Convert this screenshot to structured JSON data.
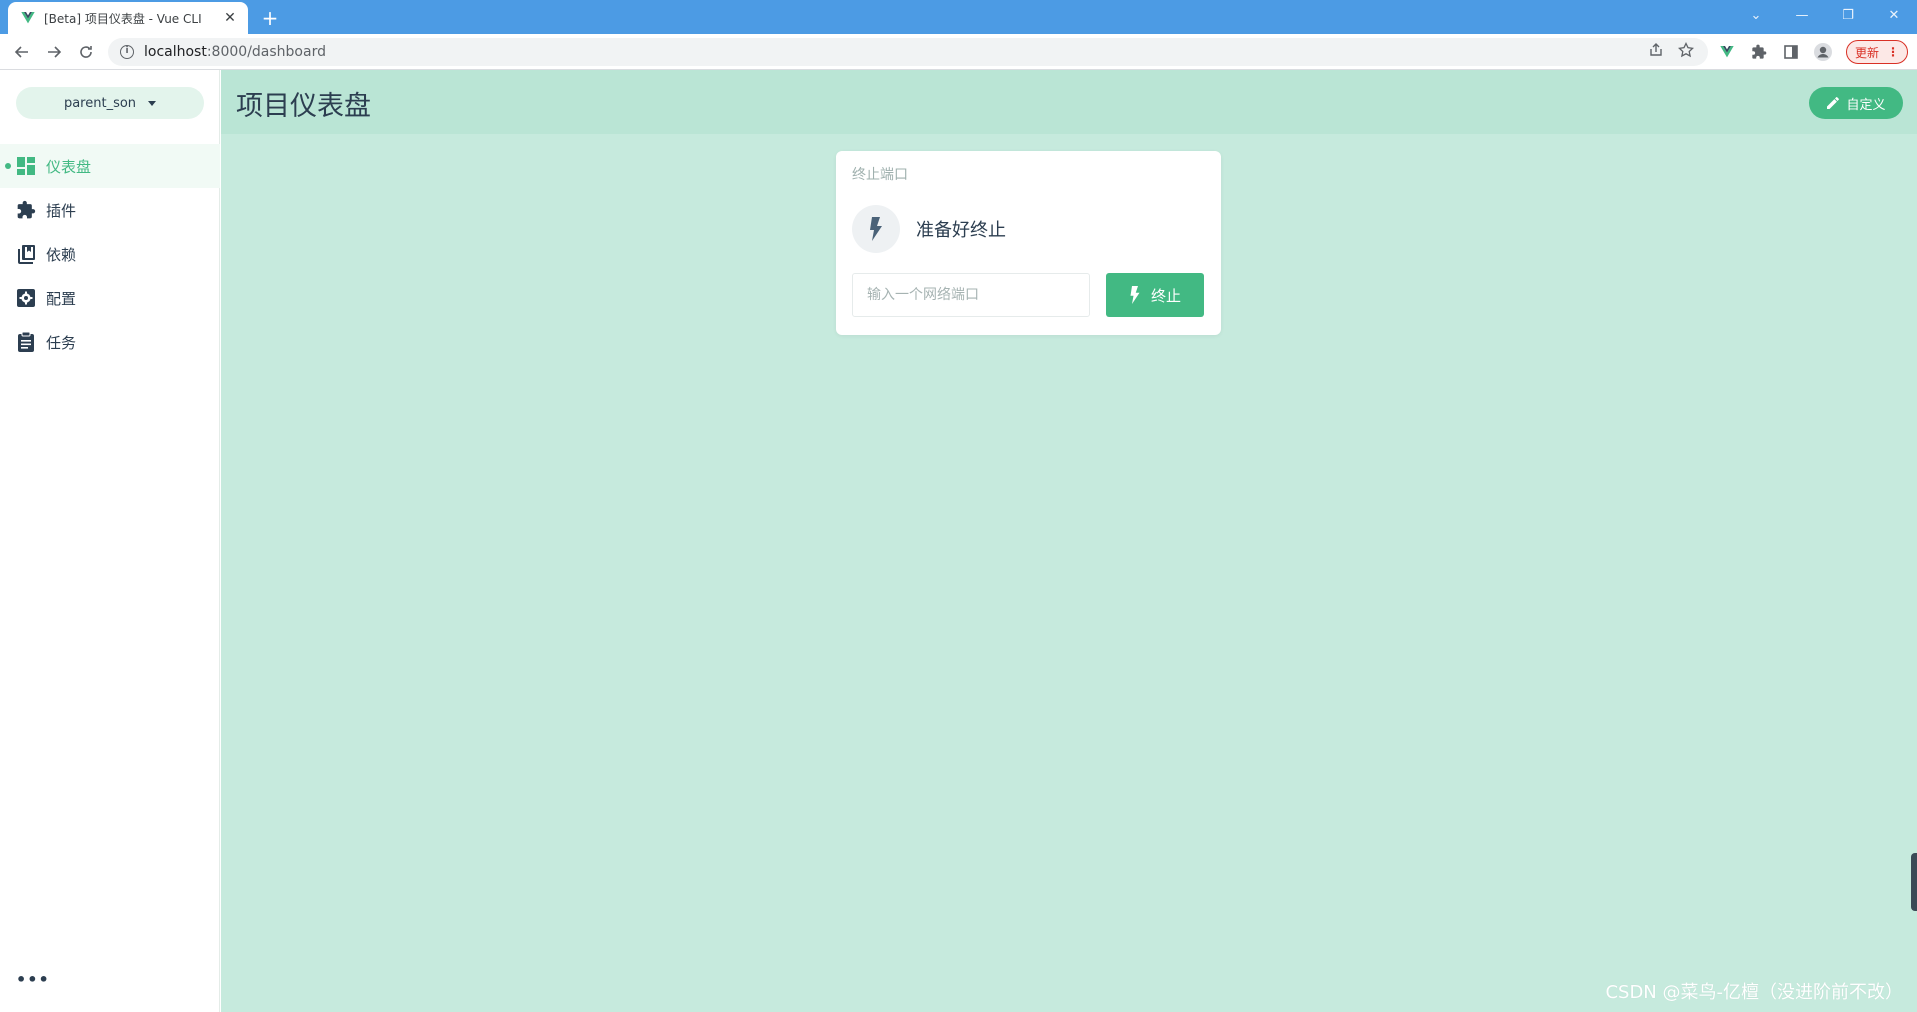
{
  "browser": {
    "tab_title": "[Beta] 项目仪表盘 - Vue CLI",
    "tab_close": "✕",
    "new_tab": "+",
    "url_host": "localhost",
    "url_path": ":8000/dashboard",
    "update_label": "更新",
    "win_minimize": "—",
    "win_restore": "❐",
    "win_close": "✕",
    "tab_search": "⌄"
  },
  "sidebar": {
    "project_name": "parent_son",
    "items": [
      {
        "label": "仪表盘",
        "icon": "dashboard-icon",
        "active": true
      },
      {
        "label": "插件",
        "icon": "puzzle-icon",
        "active": false
      },
      {
        "label": "依赖",
        "icon": "library-icon",
        "active": false
      },
      {
        "label": "配置",
        "icon": "settings-icon",
        "active": false
      },
      {
        "label": "任务",
        "icon": "clipboard-icon",
        "active": false
      }
    ],
    "more": "•••"
  },
  "header": {
    "title": "项目仪表盘",
    "customize_label": "自定义"
  },
  "widget": {
    "title": "终止端口",
    "status": "准备好终止",
    "input_placeholder": "输入一个网络端口",
    "input_value": "",
    "kill_label": "终止"
  },
  "watermark": "CSDN @菜鸟-亿檀（没进阶前不改）",
  "colors": {
    "accent": "#42b983",
    "header_bg": "#bae5d5",
    "main_bg": "#c6eadd",
    "tabbar_bg": "#4c9be4"
  }
}
